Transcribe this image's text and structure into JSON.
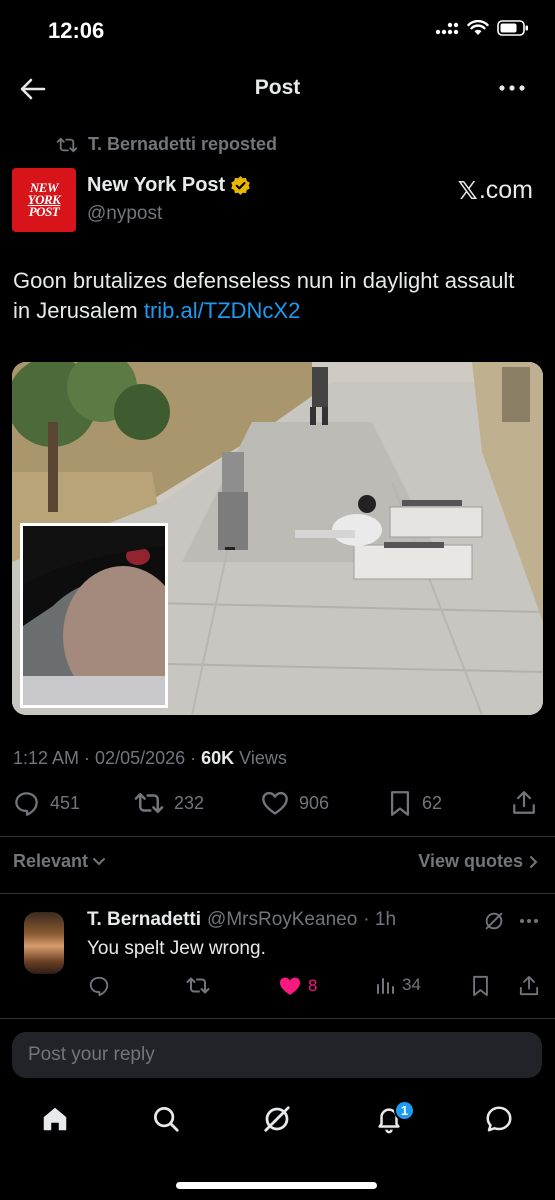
{
  "status_bar": {
    "time": "12:06"
  },
  "header": {
    "title": "Post"
  },
  "repost": {
    "text": "T. Bernadetti reposted"
  },
  "author": {
    "logo_lines": [
      "NEW",
      "YORK",
      "POST"
    ],
    "name": "New York Post",
    "handle": "@nypost",
    "verified_color": "#e8b800"
  },
  "source_badge": {
    "x": "𝕏",
    "domain": ".com"
  },
  "post": {
    "text": "Goon brutalizes defenseless nun in daylight assault in Jerusalem ",
    "link": "trib.al/TZDNcX2"
  },
  "meta": {
    "time": "1:12 AM",
    "sep1": " · ",
    "date": "02/05/2026",
    "sep2": " · ",
    "views_count": "60K",
    "views_label": " Views"
  },
  "actions": {
    "replies": "451",
    "reposts": "232",
    "likes": "906",
    "bookmarks": "62"
  },
  "filter": {
    "relevant_label": "Relevant",
    "view_quotes_label": "View quotes"
  },
  "reply": {
    "name": "T. Bernadetti",
    "handle": "@MrsRoyKeaneo",
    "time": "· 1h",
    "text": "You spelt Jew wrong.",
    "likes": "8",
    "views": "34",
    "like_color": "#f91880"
  },
  "reply_box": {
    "placeholder": "Post your reply"
  },
  "nav": {
    "notification_count": "1"
  },
  "colors": {
    "accent": "#1d9bf0",
    "muted": "#71767b",
    "text": "#e7e9ea"
  }
}
